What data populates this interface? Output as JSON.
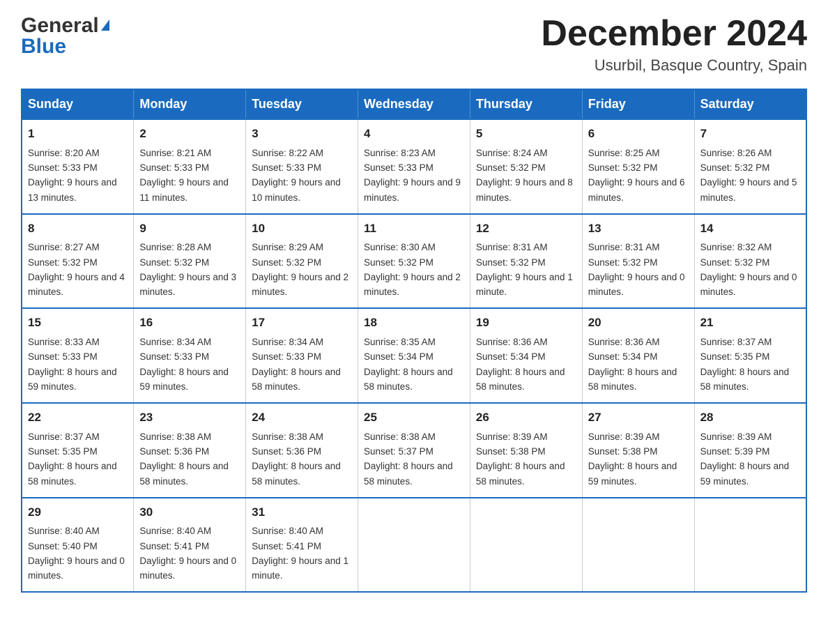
{
  "header": {
    "logo_general": "General",
    "logo_blue": "Blue",
    "month_title": "December 2024",
    "location": "Usurbil, Basque Country, Spain"
  },
  "days_of_week": [
    "Sunday",
    "Monday",
    "Tuesday",
    "Wednesday",
    "Thursday",
    "Friday",
    "Saturday"
  ],
  "weeks": [
    [
      {
        "day": "1",
        "sunrise": "8:20 AM",
        "sunset": "5:33 PM",
        "daylight": "9 hours and 13 minutes."
      },
      {
        "day": "2",
        "sunrise": "8:21 AM",
        "sunset": "5:33 PM",
        "daylight": "9 hours and 11 minutes."
      },
      {
        "day": "3",
        "sunrise": "8:22 AM",
        "sunset": "5:33 PM",
        "daylight": "9 hours and 10 minutes."
      },
      {
        "day": "4",
        "sunrise": "8:23 AM",
        "sunset": "5:33 PM",
        "daylight": "9 hours and 9 minutes."
      },
      {
        "day": "5",
        "sunrise": "8:24 AM",
        "sunset": "5:32 PM",
        "daylight": "9 hours and 8 minutes."
      },
      {
        "day": "6",
        "sunrise": "8:25 AM",
        "sunset": "5:32 PM",
        "daylight": "9 hours and 6 minutes."
      },
      {
        "day": "7",
        "sunrise": "8:26 AM",
        "sunset": "5:32 PM",
        "daylight": "9 hours and 5 minutes."
      }
    ],
    [
      {
        "day": "8",
        "sunrise": "8:27 AM",
        "sunset": "5:32 PM",
        "daylight": "9 hours and 4 minutes."
      },
      {
        "day": "9",
        "sunrise": "8:28 AM",
        "sunset": "5:32 PM",
        "daylight": "9 hours and 3 minutes."
      },
      {
        "day": "10",
        "sunrise": "8:29 AM",
        "sunset": "5:32 PM",
        "daylight": "9 hours and 2 minutes."
      },
      {
        "day": "11",
        "sunrise": "8:30 AM",
        "sunset": "5:32 PM",
        "daylight": "9 hours and 2 minutes."
      },
      {
        "day": "12",
        "sunrise": "8:31 AM",
        "sunset": "5:32 PM",
        "daylight": "9 hours and 1 minute."
      },
      {
        "day": "13",
        "sunrise": "8:31 AM",
        "sunset": "5:32 PM",
        "daylight": "9 hours and 0 minutes."
      },
      {
        "day": "14",
        "sunrise": "8:32 AM",
        "sunset": "5:32 PM",
        "daylight": "9 hours and 0 minutes."
      }
    ],
    [
      {
        "day": "15",
        "sunrise": "8:33 AM",
        "sunset": "5:33 PM",
        "daylight": "8 hours and 59 minutes."
      },
      {
        "day": "16",
        "sunrise": "8:34 AM",
        "sunset": "5:33 PM",
        "daylight": "8 hours and 59 minutes."
      },
      {
        "day": "17",
        "sunrise": "8:34 AM",
        "sunset": "5:33 PM",
        "daylight": "8 hours and 58 minutes."
      },
      {
        "day": "18",
        "sunrise": "8:35 AM",
        "sunset": "5:34 PM",
        "daylight": "8 hours and 58 minutes."
      },
      {
        "day": "19",
        "sunrise": "8:36 AM",
        "sunset": "5:34 PM",
        "daylight": "8 hours and 58 minutes."
      },
      {
        "day": "20",
        "sunrise": "8:36 AM",
        "sunset": "5:34 PM",
        "daylight": "8 hours and 58 minutes."
      },
      {
        "day": "21",
        "sunrise": "8:37 AM",
        "sunset": "5:35 PM",
        "daylight": "8 hours and 58 minutes."
      }
    ],
    [
      {
        "day": "22",
        "sunrise": "8:37 AM",
        "sunset": "5:35 PM",
        "daylight": "8 hours and 58 minutes."
      },
      {
        "day": "23",
        "sunrise": "8:38 AM",
        "sunset": "5:36 PM",
        "daylight": "8 hours and 58 minutes."
      },
      {
        "day": "24",
        "sunrise": "8:38 AM",
        "sunset": "5:36 PM",
        "daylight": "8 hours and 58 minutes."
      },
      {
        "day": "25",
        "sunrise": "8:38 AM",
        "sunset": "5:37 PM",
        "daylight": "8 hours and 58 minutes."
      },
      {
        "day": "26",
        "sunrise": "8:39 AM",
        "sunset": "5:38 PM",
        "daylight": "8 hours and 58 minutes."
      },
      {
        "day": "27",
        "sunrise": "8:39 AM",
        "sunset": "5:38 PM",
        "daylight": "8 hours and 59 minutes."
      },
      {
        "day": "28",
        "sunrise": "8:39 AM",
        "sunset": "5:39 PM",
        "daylight": "8 hours and 59 minutes."
      }
    ],
    [
      {
        "day": "29",
        "sunrise": "8:40 AM",
        "sunset": "5:40 PM",
        "daylight": "9 hours and 0 minutes."
      },
      {
        "day": "30",
        "sunrise": "8:40 AM",
        "sunset": "5:41 PM",
        "daylight": "9 hours and 0 minutes."
      },
      {
        "day": "31",
        "sunrise": "8:40 AM",
        "sunset": "5:41 PM",
        "daylight": "9 hours and 1 minute."
      },
      null,
      null,
      null,
      null
    ]
  ],
  "labels": {
    "sunrise": "Sunrise:",
    "sunset": "Sunset:",
    "daylight": "Daylight:"
  }
}
